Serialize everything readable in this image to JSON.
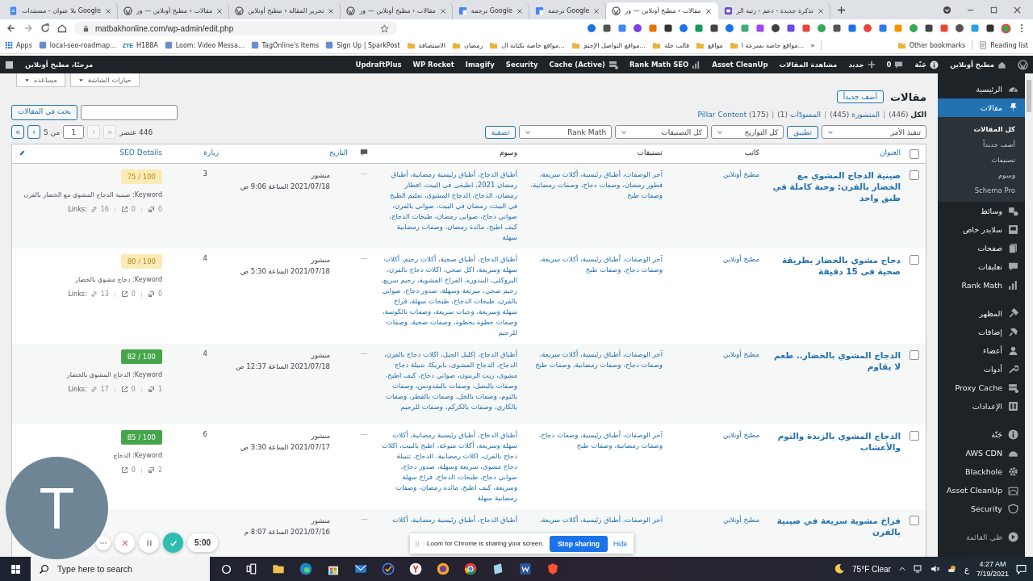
{
  "browser": {
    "tabs": [
      {
        "title": "تذكرة جديدة - دعم - رتبة الر",
        "kind": "ticket",
        "selected": false
      },
      {
        "title": "مقالات ‹ مطبخ أونلاين — ور",
        "kind": "wp",
        "selected": true
      },
      {
        "title": "ترجمة Google",
        "kind": "translate",
        "selected": false
      },
      {
        "title": "ترجمة Google",
        "kind": "translate",
        "selected": false
      },
      {
        "title": "مقالات ‹ مطبخ أونلاين — ور",
        "kind": "wp",
        "selected": false
      },
      {
        "title": "تحرير المقالة ‹ مطبخ أونلاين",
        "kind": "wp",
        "selected": false
      },
      {
        "title": "مقالات ‹ مطبخ أونلاين — ور",
        "kind": "wp",
        "selected": false
      },
      {
        "title": "بلا عنوان - مستندات Google",
        "kind": "docs",
        "selected": false
      }
    ],
    "address": "matbakhonline.com/wp-admin/edit.php",
    "bookmarks": [
      {
        "label": "مواقع خاصة بسرعة ا...",
        "kind": "folder"
      },
      {
        "label": "مواقع",
        "kind": "folder"
      },
      {
        "label": "قالب جلة",
        "kind": "folder"
      },
      {
        "label": "مواقع التواصل الإجتم...",
        "kind": "folder"
      },
      {
        "label": "مواقع خاصة بكتابة ال...",
        "kind": "folder"
      },
      {
        "label": "رمضان",
        "kind": "folder"
      },
      {
        "label": "الاستضافة",
        "kind": "folder"
      },
      {
        "label": "Sign Up | SparkPost",
        "kind": "site"
      },
      {
        "label": "TagOnline's Items",
        "kind": "site"
      },
      {
        "label": "Loom: Video Messa...",
        "kind": "site"
      },
      {
        "label": "H188A",
        "kind": "zte",
        "badge": "ZTE"
      },
      {
        "label": "local-seo-roadmap...",
        "kind": "site"
      },
      {
        "label": "Apps",
        "kind": "apps"
      }
    ],
    "more": "»",
    "other_bookmarks": "Other bookmarks",
    "reading_list": "Reading list"
  },
  "admin_bar": {
    "items": [
      {
        "label": "مطبخ أونلاين",
        "kind": "site"
      },
      {
        "label": "جَنّة",
        "kind": "user"
      },
      {
        "label": "0",
        "kind": "comments"
      },
      {
        "label": "جديد",
        "kind": "new"
      },
      {
        "label": "مشاهدة المقالات",
        "kind": "plain"
      },
      {
        "label": "Asset CleanUp",
        "kind": "plain"
      },
      {
        "label": "Rank Math SEO",
        "kind": "rankmath"
      },
      {
        "label": "Cache (Active)",
        "kind": "cache"
      },
      {
        "label": "Security",
        "kind": "plain"
      },
      {
        "label": "Imagify",
        "kind": "plain"
      },
      {
        "label": "WP Rocket",
        "kind": "plain"
      },
      {
        "label": "UpdraftPlus",
        "kind": "plain"
      }
    ],
    "greeting": "مرحبًا، مطبخ أونلاين"
  },
  "sidebar": {
    "groups": [
      {
        "items": [
          {
            "label": "الرئيسية",
            "selected": false
          },
          {
            "label": "مقالات",
            "selected": true,
            "children": [
              {
                "label": "كل المقالات",
                "selected": true
              },
              {
                "label": "أضف جديداً",
                "selected": false
              },
              {
                "label": "تصنيفات",
                "selected": false
              },
              {
                "label": "وسوم",
                "selected": false
              },
              {
                "label": "Schema Pro",
                "selected": false
              }
            ]
          },
          {
            "label": "وسائط",
            "selected": false
          },
          {
            "label": "سلايدر خاص",
            "selected": false
          },
          {
            "label": "صفحات",
            "selected": false
          },
          {
            "label": "تعليقات",
            "selected": false
          },
          {
            "label": "Rank Math",
            "selected": false
          }
        ]
      },
      {
        "items": [
          {
            "label": "المظهر",
            "selected": false
          },
          {
            "label": "إضافات",
            "selected": false
          },
          {
            "label": "أعضاء",
            "selected": false
          },
          {
            "label": "أدوات",
            "selected": false
          },
          {
            "label": "Proxy Cache",
            "selected": false
          },
          {
            "label": "الإعدادات",
            "selected": false
          }
        ]
      },
      {
        "items": [
          {
            "label": "جَنّة",
            "selected": false
          },
          {
            "label": "AWS CDN",
            "selected": false
          },
          {
            "label": "Blackhole",
            "selected": false
          },
          {
            "label": "Asset CleanUp",
            "selected": false
          },
          {
            "label": "Security",
            "selected": false
          }
        ]
      }
    ],
    "collapse": "طي القائمة"
  },
  "page": {
    "screen_options": "خيارات الشاشة",
    "help": "مساعدة",
    "title": "مقالات",
    "add_new": "أضف جديداً",
    "views": [
      {
        "label": "الكل",
        "count": "(446)",
        "selected": true
      },
      {
        "label": "المنشورة",
        "count": "(445)",
        "selected": false
      },
      {
        "label": "المسودّات",
        "count": "(1)",
        "selected": false
      },
      {
        "label": "Pillar Content",
        "count": "(175)",
        "selected": false
      }
    ],
    "separator": "|",
    "search_button": "بحث في المقالات",
    "bulk_action": "تنفيذ الأمر",
    "apply": "تطبيق",
    "filters": [
      "كل التواريخ",
      "كل التصنيفات",
      "Rank Math"
    ],
    "filter_button": "تصفية",
    "pagination": {
      "count": "446 عنصر",
      "buttons": [
        {
          "label": "«",
          "disabled": true
        },
        {
          "label": "‹",
          "disabled": true
        }
      ],
      "page": "1",
      "of": "من 5",
      "next_buttons": [
        {
          "label": "›",
          "disabled": false
        },
        {
          "label": "»",
          "disabled": false
        }
      ]
    }
  },
  "table": {
    "header_checked": false,
    "columns": [
      {
        "label": "العنوان",
        "sortable": true
      },
      {
        "label": "كاتب",
        "sortable": false
      },
      {
        "label": "تصنيفات",
        "sortable": false
      },
      {
        "label": "وسوم",
        "sortable": false
      },
      {
        "kind": "comments"
      },
      {
        "label": "التاريخ",
        "sortable": true
      },
      {
        "label": "زيارة",
        "sortable": true
      },
      {
        "label": "SEO Details",
        "sortable": true
      }
    ],
    "rows": [
      {
        "checked": false,
        "title": "صينية الدجاج المشوي مع الخضار بالفرن: وجبة كاملة في طبق واحد",
        "author": "مطبخ أونلاين",
        "categories": "آخر الوصفات، أطباق رئيسية، أكلات سريعة، فطور رمضان، وصفات دجاج، وصفات رمضانية، وصفات طبخ",
        "tags": "أطباق الدجاج، أطباق رئيسية رمضانية، أطباق رمضان 2021، اطبخى فى البيت، افطار رمضان، الدجاج، الدجاج المشوى، تعليم الطبخ في البيت، رمضان في البيت، صواني بالفرن، صواني دجاج، صوانى رمضان، طبخات الدجاج، كيف اطبخ، مائدة رمضان، وصفات رمضانية سهلة",
        "comments": "—",
        "status": "منشور",
        "date": "2021/07/18 الساعة 9:06 ص",
        "visits": "3",
        "score": "100 / 75",
        "color": "#fcebb5",
        "keyword": "Keyword: صينية الدجاج المشوي مع الخضار بالفرن",
        "links": {
          "label": "Links:",
          "internal": "16",
          "external": "0",
          "incoming": "0"
        }
      },
      {
        "checked": false,
        "title": "دجاج مشوي بالخضار بطريقة صحية فى 15 دقيقة",
        "author": "مطبخ أونلاين",
        "categories": "آخر الوصفات، أطباق رئيسية، أكلات سريعة، وصفات دجاج، وصفات طبخ",
        "tags": "أطباق الدجاج، أطباق صحية، أكلات رجيم، أكلات سهلة وسريعة، اكل صحي، اكلات دجاج بالفرن، البروكلى، البندورة، الفراخ المشوية، رجيم سريع، رجيم صحي، سريعة وسهلة، صدور دجاج، صواني بالفرن، طبخات الدجاج، طبخات سهلة، فراخ سهلة وسريعة، وجبات سريعة، وصفات بالكوسة، وصفات خطوة بخطوة، وصفات صحية، وصفات للرجيم",
        "comments": "—",
        "status": "منشور",
        "date": "2021/07/18 الساعة 5:30 ص",
        "visits": "4",
        "score": "100 / 80",
        "color": "#fcebb5",
        "keyword": "Keyword: دجاج مشوي بالخضار",
        "links": {
          "label": "Links:",
          "internal": "13",
          "external": "0",
          "incoming": "0"
        }
      },
      {
        "checked": false,
        "title": "الدجاج المشوي بالخضار.. طعم لا يقاوم",
        "author": "مطبخ أونلاين",
        "categories": "آخر الوصفات، أطباق رئيسية، أكلات سريعة، وصفات دجاج، وصفات رمضانية، وصفات طبخ",
        "tags": "أطباق الدجاج، إكليل الجبل، اكلات دجاج بالفرن، الدجاج، الدجاج المشوى، بابريكا، تتبيلة دجاج مشوى، زيت الزيتون، صواني دجاج، كيف اطبخ، وصفات بالبصل، وصفات بالبقدونس، وصفات بالثوم، وصفات بالخل، وصفات بالقطر، وصفات بالكاري، وصفات بالكركم، وصفات للرجيم",
        "comments": "—",
        "status": "منشور",
        "date": "2021/07/18 الساعة 12:37 ص",
        "visits": "4",
        "score": "100 / 82",
        "color": "#46a54a",
        "keyword": "Keyword: الدجاج المشوي بالخضار",
        "links": {
          "label": "Links:",
          "internal": "17",
          "external": "0",
          "incoming": "1"
        }
      },
      {
        "checked": false,
        "title": "الدجاج المشوي بالزبدة والثوم والأعشاب",
        "author": "مطبخ أونلاين",
        "categories": "آخر الوصفات، أطباق رئيسية، وصفات دجاج، وصفات رمضانية، وصفات طبخ",
        "tags": "أطباق الدجاج، أطباق رئيسية رمضانية، أكلات سهلة وسريعة، أكلات منوعة، اطبخ بالبيت، اكلات دجاج بالفرن، اكلات رمضانية، الدجاج، تتبيلة دجاج مشوى، سريعة وسهلة، صدور دجاج، صواني دجاج، طبخات الدجاج، فراخ سهلة وسريعة، كيف اطبخ، مائدة رمضان، وصفات رمضانية سهلة",
        "comments": "—",
        "status": "منشور",
        "date": "2021/07/17 الساعة 3:30 ص",
        "visits": "6",
        "score": "100 / 85",
        "color": "#46a54a",
        "keyword": "Keyword: الدجاج",
        "links": {
          "external": "0",
          "incoming": "2"
        }
      },
      {
        "checked": false,
        "title": "فراخ مشوية سريعة في صينية بالفرن",
        "author": "مطبخ أونلاين",
        "categories": "آخر الوصفات، أطباق رئيسية، أكلات سريعة،",
        "tags": "أطباق الدجاج، أطباق رئيسية رمضانية، أكلات",
        "comments": "—",
        "status": "منشور",
        "date": "2021/07/16 الساعة 8:07 م"
      }
    ]
  },
  "loom": {
    "avatar": "T",
    "timer": "5:00",
    "notice": "Loom for Chrome is sharing your screen.",
    "stop": "Stop sharing",
    "hide": "Hide"
  },
  "taskbar": {
    "search_placeholder": "Type here to search",
    "weather": "75°F Clear",
    "language": "ع",
    "time": "4:27 AM",
    "date": "7/19/2021"
  }
}
